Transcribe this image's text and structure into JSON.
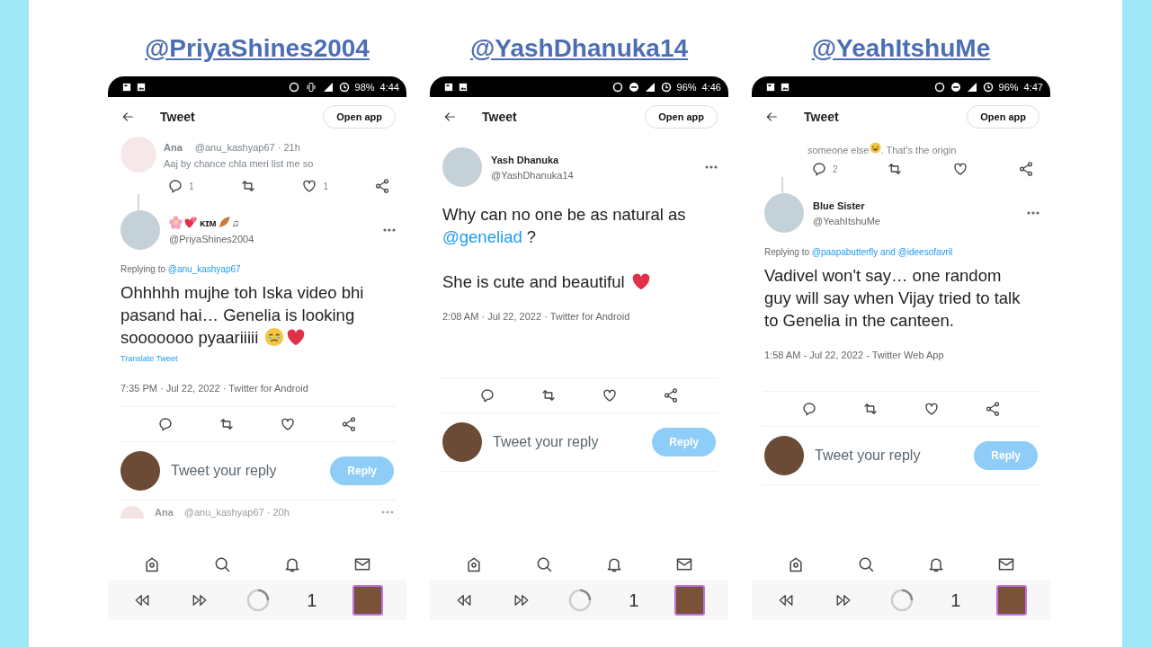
{
  "panels": [
    {
      "heading": "@PriyaShines2004",
      "status_bar": {
        "icons": [
          {
            "kind": "data_saver"
          },
          {
            "kind": "vibrate"
          },
          {
            "kind": "signal"
          },
          {
            "kind": "alarm"
          }
        ],
        "battery": "98%",
        "time": "4:44"
      },
      "header": {
        "title": "Tweet",
        "button": "Open app"
      },
      "parent_tweet": {
        "name": "Ana",
        "handle": "@anu_kashyap67 · 21h",
        "text": [
          {
            "kind": "text",
            "text": "Aaj by chance chla meri list me so"
          }
        ],
        "reply_count": "1",
        "like_count": "1"
      },
      "tweet": {
        "name": [
          {
            "kind": "flower"
          },
          {
            "kind": "hearts"
          },
          {
            "kind": "text",
            "text": "ᴋɪᴍ"
          },
          {
            "kind": "feather"
          },
          {
            "kind": "text",
            "text": "♫"
          }
        ],
        "handle": "@PriyaShines2004",
        "replying_to": {
          "label": "Replying to",
          "mentions": "@anu_kashyap67"
        },
        "paragraphs": [
          [
            {
              "kind": "text",
              "text": "Ohhhhh mujhe toh Iska video bhi pasand hai… Genelia is looking sooooooo pyaariiiii "
            },
            {
              "kind": "teary"
            },
            {
              "kind": "heart"
            }
          ]
        ],
        "translate": "Translate Tweet",
        "meta": "7:35 PM · Jul 22, 2022 · Twitter for Android"
      },
      "reply_box": {
        "placeholder": "Tweet your reply",
        "button": "Reply",
        "disabled": true
      },
      "next_tweet": {
        "name": "Ana",
        "handle": "@anu_kashyap67 · 20h"
      },
      "browser": {
        "tab_count": "1"
      }
    },
    {
      "heading": "@YashDhanuka14",
      "status_bar": {
        "icons": [
          {
            "kind": "data_saver"
          },
          {
            "kind": "dnd"
          },
          {
            "kind": "signal"
          },
          {
            "kind": "alarm"
          }
        ],
        "battery": "96%",
        "time": "4:46"
      },
      "header": {
        "title": "Tweet",
        "button": "Open app"
      },
      "tweet": {
        "name": [
          {
            "kind": "text",
            "text": "Yash Dhanuka"
          }
        ],
        "handle": "@YashDhanuka14",
        "paragraphs": [
          [
            {
              "kind": "text",
              "text": "Why can no one be as natural as "
            },
            {
              "kind": "mention",
              "text": "@geneliad"
            },
            {
              "kind": "text",
              "text": " ?"
            }
          ],
          [
            {
              "kind": "text",
              "text": "She is cute and beautiful "
            },
            {
              "kind": "heart"
            }
          ]
        ],
        "meta": "2:08 AM · Jul 22, 2022 · Twitter for Android"
      },
      "reply_box": {
        "placeholder": "Tweet your reply",
        "button": "Reply",
        "disabled": true
      },
      "browser": {
        "tab_count": "1"
      }
    },
    {
      "heading": "@YeahItshuMe",
      "status_bar": {
        "icons": [
          {
            "kind": "data_saver"
          },
          {
            "kind": "dnd"
          },
          {
            "kind": "signal"
          },
          {
            "kind": "alarm"
          }
        ],
        "battery": "96%",
        "time": "4:47"
      },
      "header": {
        "title": "Tweet",
        "button": "Open app"
      },
      "parent_tweet": {
        "text": [
          {
            "kind": "text",
            "text": "someone else"
          },
          {
            "kind": "laughing"
          },
          {
            "kind": "text",
            "text": ". That's the origin"
          }
        ],
        "reply_count": "2"
      },
      "tweet": {
        "name": [
          {
            "kind": "text",
            "text": "Blue Sister"
          }
        ],
        "handle": "@YeahItshuMe",
        "replying_to": {
          "label": "Replying to",
          "mentions": "@paapabutterfly and @ideesofavril"
        },
        "paragraphs": [
          [
            {
              "kind": "text",
              "text": "Vadivel won't say… one random guy will say when Vijay tried to talk to Genelia in the canteen."
            }
          ]
        ],
        "meta": "1:58 AM - Jul 22, 2022 - Twitter Web App"
      },
      "reply_box": {
        "placeholder": "Tweet your reply",
        "button": "Reply",
        "disabled": true
      },
      "browser": {
        "tab_count": "1"
      }
    }
  ]
}
